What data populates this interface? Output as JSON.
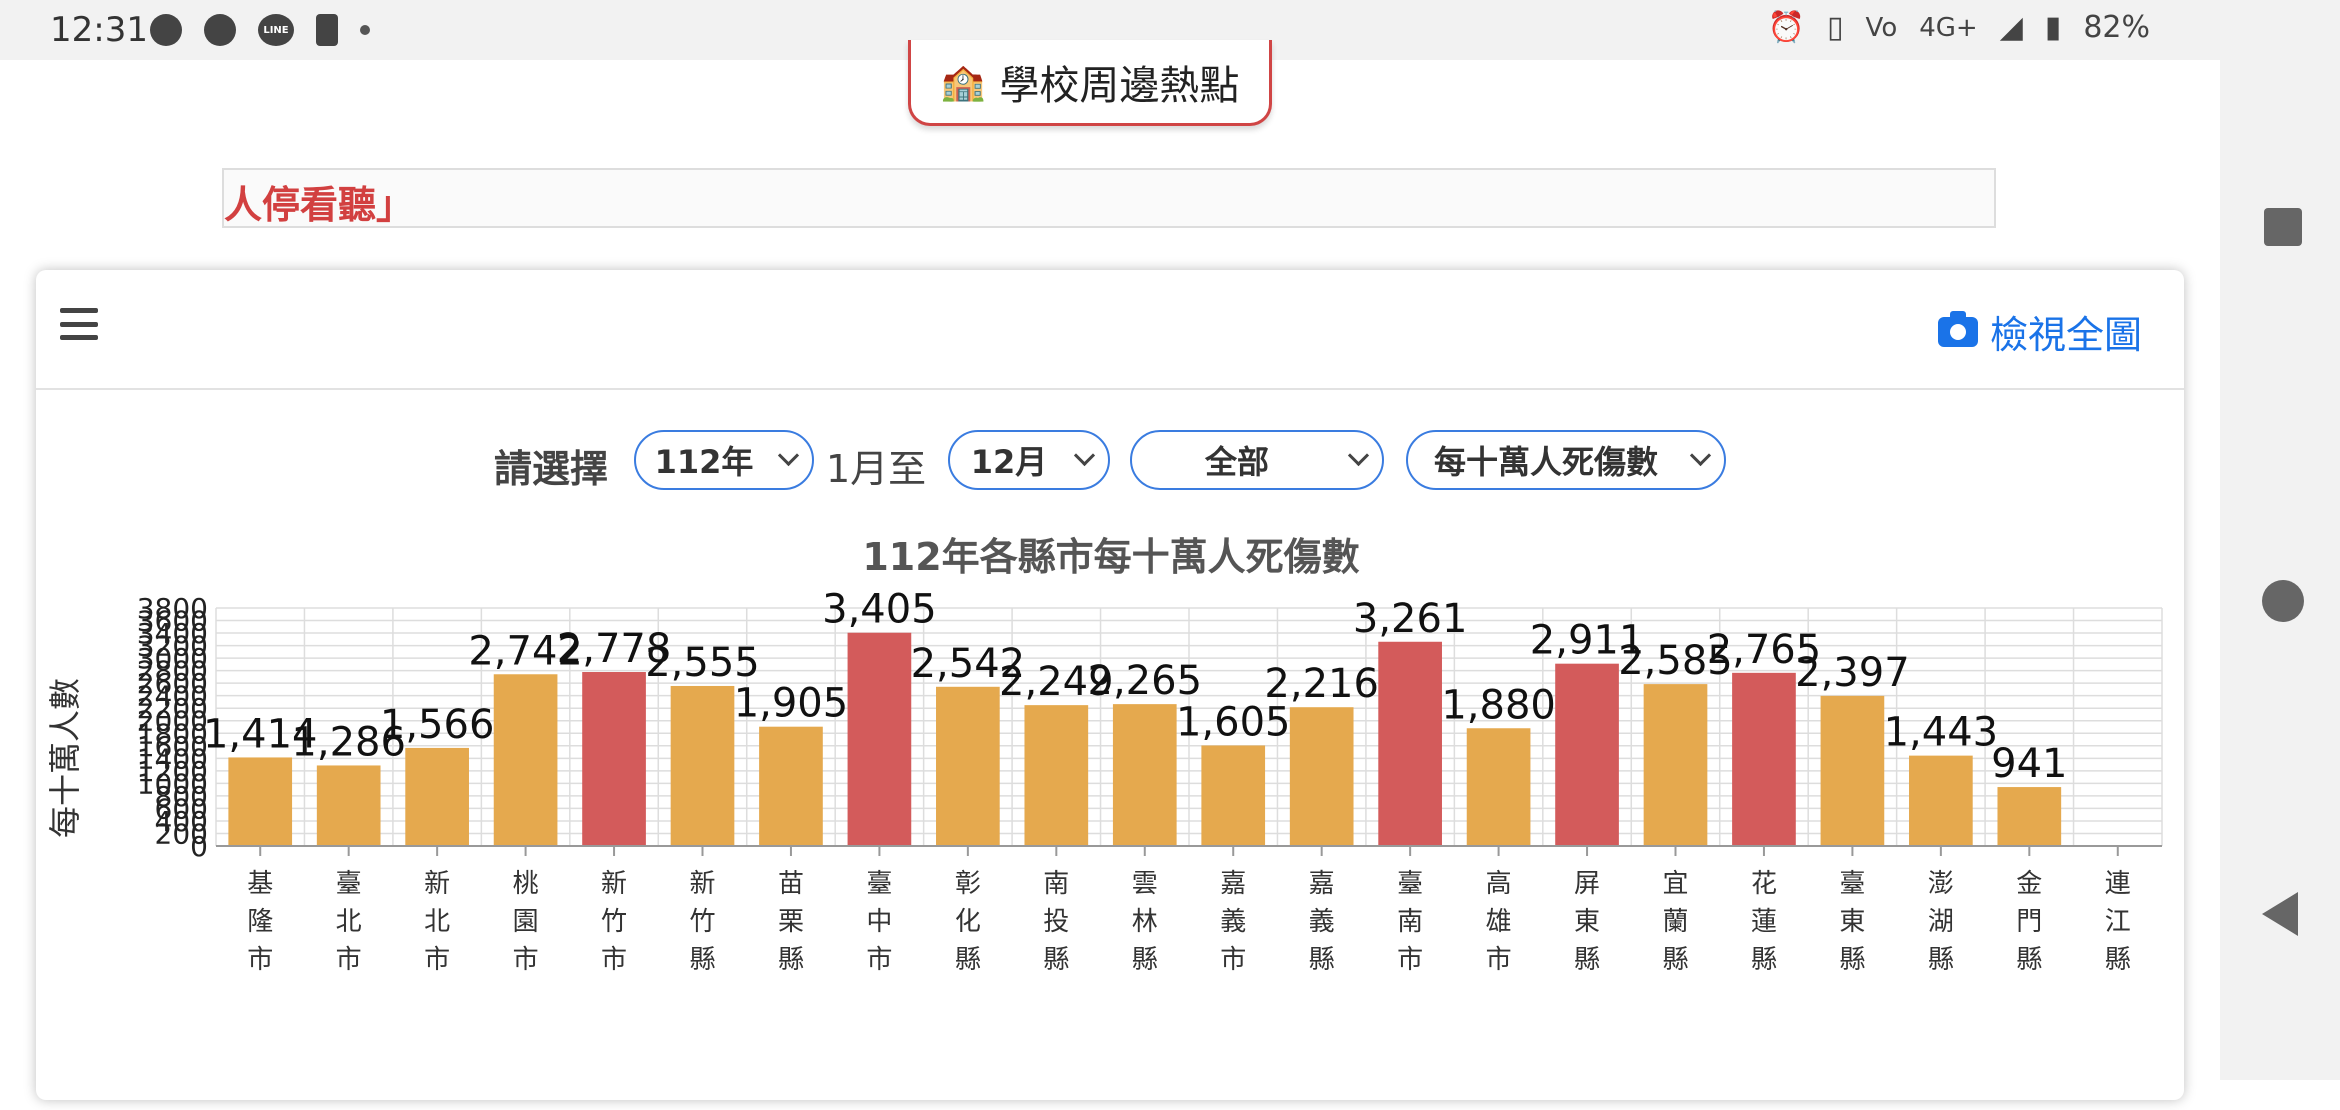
{
  "status": {
    "time": "12:31",
    "battery": "82%",
    "network": "4G+"
  },
  "page": {
    "hot_button": "學校周邊熱點",
    "banner_text": "人停看聽」"
  },
  "card": {
    "view_all": "檢視全圖",
    "controls": {
      "label": "請選擇",
      "year": "112年",
      "from_text": "1月至",
      "month": "12月",
      "scope": "全部",
      "metric": "每十萬人死傷數"
    }
  },
  "colors": {
    "bar_normal": "#E5A94E",
    "bar_high": "#D35B5B",
    "accent": "#1a73e8"
  },
  "chart_data": {
    "type": "bar",
    "title": "112年各縣市每十萬人死傷數",
    "ylabel": "每十萬人數",
    "xlabel": "",
    "ylim": [
      0,
      3800
    ],
    "yticks": [
      0,
      200,
      400,
      600,
      800,
      1000,
      1200,
      1400,
      1600,
      1800,
      2000,
      2200,
      2400,
      2600,
      2800,
      3000,
      3200,
      3400,
      3600,
      3800
    ],
    "grid": true,
    "categories": [
      "基隆市",
      "臺北市",
      "新北市",
      "桃園市",
      "新竹市",
      "新竹縣",
      "苗栗縣",
      "臺中市",
      "彰化縣",
      "南投縣",
      "雲林縣",
      "嘉義市",
      "嘉義縣",
      "臺南市",
      "高雄市",
      "屏東縣",
      "宜蘭縣",
      "花蓮縣",
      "臺東縣",
      "澎湖縣",
      "金門縣",
      "連江縣"
    ],
    "values": [
      1414,
      1286,
      1566,
      2742,
      2778,
      2555,
      1905,
      3405,
      2542,
      2249,
      2265,
      1605,
      2216,
      3261,
      1880,
      2911,
      2585,
      2765,
      2397,
      1443,
      941,
      null
    ],
    "data_labels": [
      "1,414",
      "1,286",
      "1,566",
      "2,742",
      "2,778",
      "2,555",
      "1,905",
      "3,405",
      "2,542",
      "2,249",
      "2,265",
      "1,605",
      "2,216",
      "3,261",
      "1,880",
      "2,911",
      "2,585",
      "2,765",
      "2,397",
      "1,443",
      "941",
      ""
    ],
    "highlight": [
      false,
      false,
      false,
      false,
      true,
      false,
      false,
      true,
      false,
      false,
      false,
      false,
      false,
      true,
      false,
      true,
      false,
      true,
      false,
      false,
      false,
      false
    ]
  }
}
